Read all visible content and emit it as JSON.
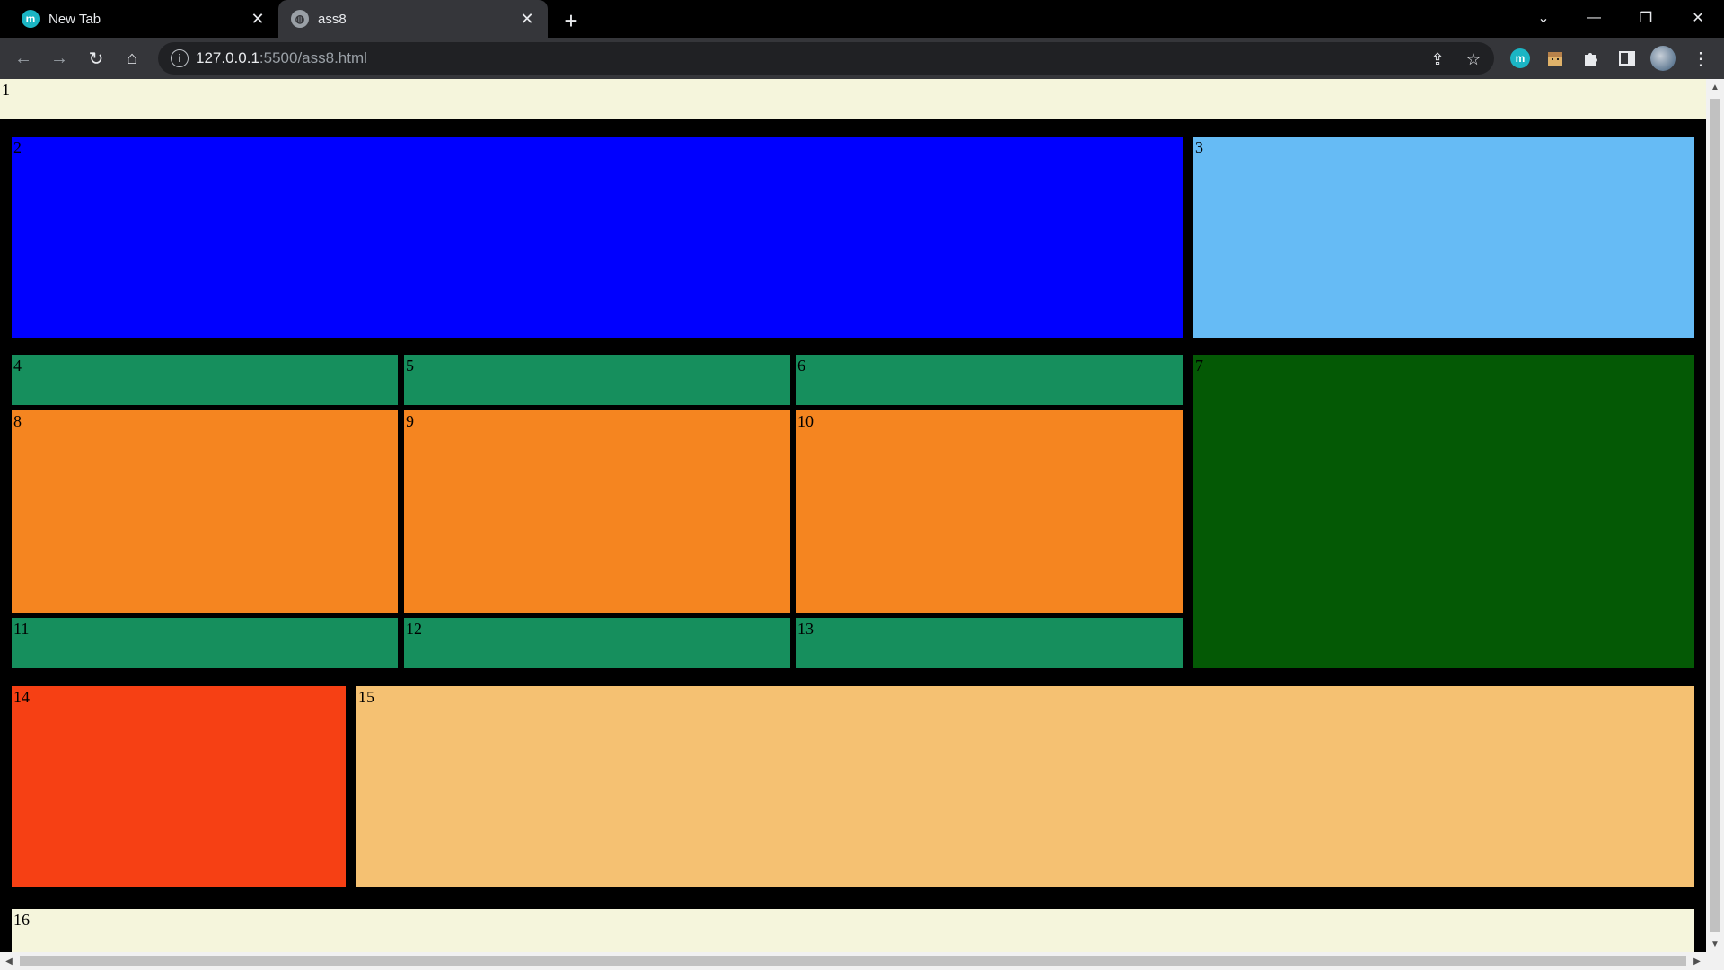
{
  "browser": {
    "tabs": [
      {
        "label": "New Tab",
        "favicon": "m",
        "active": false
      },
      {
        "label": "ass8",
        "favicon": "globe-icon",
        "active": true
      }
    ],
    "new_tab_symbol": "+",
    "url_host": "127.0.0.1",
    "url_path": ":5500/ass8.html",
    "window_controls": [
      "⌄",
      "—",
      "❐",
      "✕"
    ],
    "nav_glyphs": {
      "back": "←",
      "forward": "→",
      "reload": "↻",
      "home": "⌂"
    },
    "extension_m_label": "m"
  },
  "page": {
    "boxes": [
      {
        "label": "1",
        "color": "#f5f5dc"
      },
      {
        "label": "2",
        "color": "#0000ff"
      },
      {
        "label": "3",
        "color": "#66bbf5"
      },
      {
        "label": "4",
        "color": "#168f5d"
      },
      {
        "label": "5",
        "color": "#168f5d"
      },
      {
        "label": "6",
        "color": "#168f5d"
      },
      {
        "label": "7",
        "color": "#045905"
      },
      {
        "label": "8",
        "color": "#f58520"
      },
      {
        "label": "9",
        "color": "#f58520"
      },
      {
        "label": "10",
        "color": "#f58520"
      },
      {
        "label": "11",
        "color": "#168f5d"
      },
      {
        "label": "12",
        "color": "#168f5d"
      },
      {
        "label": "13",
        "color": "#168f5d"
      },
      {
        "label": "14",
        "color": "#f64014"
      },
      {
        "label": "15",
        "color": "#f5c172"
      },
      {
        "label": "16",
        "color": "#f5f5dc"
      }
    ]
  }
}
